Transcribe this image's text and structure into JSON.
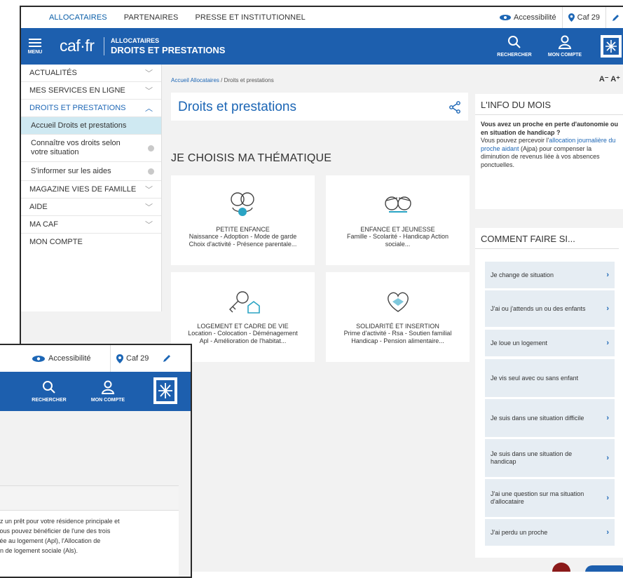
{
  "topnav": [
    "ALLOCATAIRES",
    "PARTENAIRES",
    "PRESSE ET INSTITUTIONNEL"
  ],
  "topright": {
    "accessibility": "Accessibilité",
    "caf": "Caf 29"
  },
  "header": {
    "menu": "MENU",
    "logo": "caf·fr",
    "context_line1": "ALLOCATAIRES",
    "context_line2": "DROITS ET PRESTATIONS",
    "search": "RECHERCHER",
    "account": "MON COMPTE"
  },
  "sidebar": {
    "items": [
      {
        "label": "ACTUALITÉS"
      },
      {
        "label": "MES SERVICES EN LIGNE"
      },
      {
        "label": "DROITS ET PRESTATIONS"
      },
      {
        "label": "MAGAZINE VIES DE FAMILLE"
      },
      {
        "label": "AIDE"
      },
      {
        "label": "MA CAF"
      },
      {
        "label": "MON COMPTE"
      }
    ],
    "subitems": [
      {
        "label": "Accueil Droits et prestations"
      },
      {
        "label": "Connaître vos droits selon votre situation"
      },
      {
        "label": "S'informer sur les aides"
      }
    ]
  },
  "breadcrumb": {
    "link": "Accueil Allocataires",
    "sep": " / ",
    "current": "Droits et prestations"
  },
  "font_controls": "A⁻ A⁺",
  "main": {
    "title": "Droits et prestations",
    "section": "JE CHOISIS MA THÉMATIQUE",
    "themes": [
      {
        "title": "PETITE ENFANCE",
        "line1": "Naissance - Adoption - Mode de garde",
        "line2": "Choix d'activité - Présence parentale..."
      },
      {
        "title": "ENFANCE ET JEUNESSE",
        "line1": "Famille - Scolarité - Handicap Action",
        "line2": "sociale..."
      },
      {
        "title": "LOGEMENT ET CADRE DE VIE",
        "line1": "Location - Colocation - Déménagement",
        "line2": "Apl - Amélioration de l'habitat..."
      },
      {
        "title": "SOLIDARITÉ ET INSERTION",
        "line1": "Prime d'activité - Rsa - Soutien familial",
        "line2": "Handicap - Pension alimentaire..."
      }
    ]
  },
  "info": {
    "heading": "L'INFO DU MOIS",
    "bold": "Vous avez un proche en perte d'autonomie ou en situation de handicap ?",
    "text_before": "Vous pouvez percevoir l'",
    "link": "allocation journalière du proche aidant",
    "text_after": " (Ajpa) pour compenser la diminution de revenus liée à vos absences ponctuelles."
  },
  "comment": {
    "heading": "COMMENT FAIRE SI...",
    "items": [
      "Je change de situation",
      "J'ai ou j'attends un ou des enfants",
      "Je loue un logement",
      "Je vis seul avec ou sans enfant",
      "Je suis dans une situation difficile",
      "Je suis dans une situation de handicap",
      "J'ai une question sur ma situation d'allocataire",
      "J'ai perdu un proche"
    ]
  },
  "overlay": {
    "accessibility": "Accessibilité",
    "caf": "Caf 29",
    "search": "RECHERCHER",
    "account": "MON COMPTE",
    "lines": [
      "ez un prêt pour votre résidence principale et",
      "vous pouvez bénéficier de l'une des trois",
      "sée au logement (Apl), l'Allocation de",
      "on de logement sociale (Als)."
    ]
  },
  "colors": {
    "brand_blue": "#1d5fae",
    "link_blue": "#1c66b5",
    "selected_bg": "#cfe9f2",
    "page_bg": "#f2f2f2"
  }
}
